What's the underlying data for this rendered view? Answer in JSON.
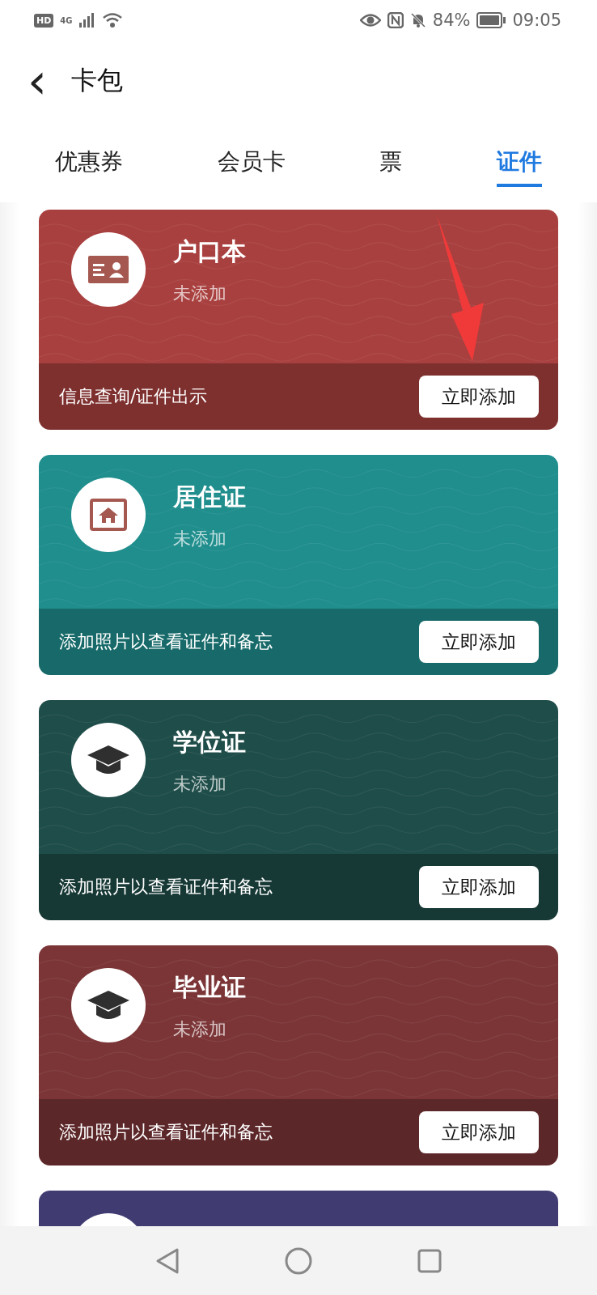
{
  "status_bar": {
    "hd": "HD",
    "network": "4G",
    "battery_percent": "84%",
    "time": "09:05"
  },
  "header": {
    "back": "‹",
    "title": "卡包"
  },
  "tabs": [
    {
      "label": "优惠券",
      "selected": false
    },
    {
      "label": "会员卡",
      "selected": false
    },
    {
      "label": "票",
      "selected": false
    },
    {
      "label": "证件",
      "selected": true
    }
  ],
  "cards": [
    {
      "kind": "id-card",
      "color": "#a8403f",
      "title": "户口本",
      "status": "未添加",
      "description": "信息查询/证件出示",
      "button": "立即添加"
    },
    {
      "kind": "house",
      "color": "#1f8e8d",
      "title": "居住证",
      "status": "未添加",
      "description": "添加照片以查看证件和备忘",
      "button": "立即添加"
    },
    {
      "kind": "cap",
      "color": "#1f4d49",
      "title": "学位证",
      "status": "未添加",
      "description": "添加照片以查看证件和备忘",
      "button": "立即添加"
    },
    {
      "kind": "cap",
      "color": "#7b3537",
      "title": "毕业证",
      "status": "未添加",
      "description": "添加照片以查看证件和备忘",
      "button": "立即添加"
    },
    {
      "kind": "partial",
      "color": "#403c72"
    }
  ]
}
